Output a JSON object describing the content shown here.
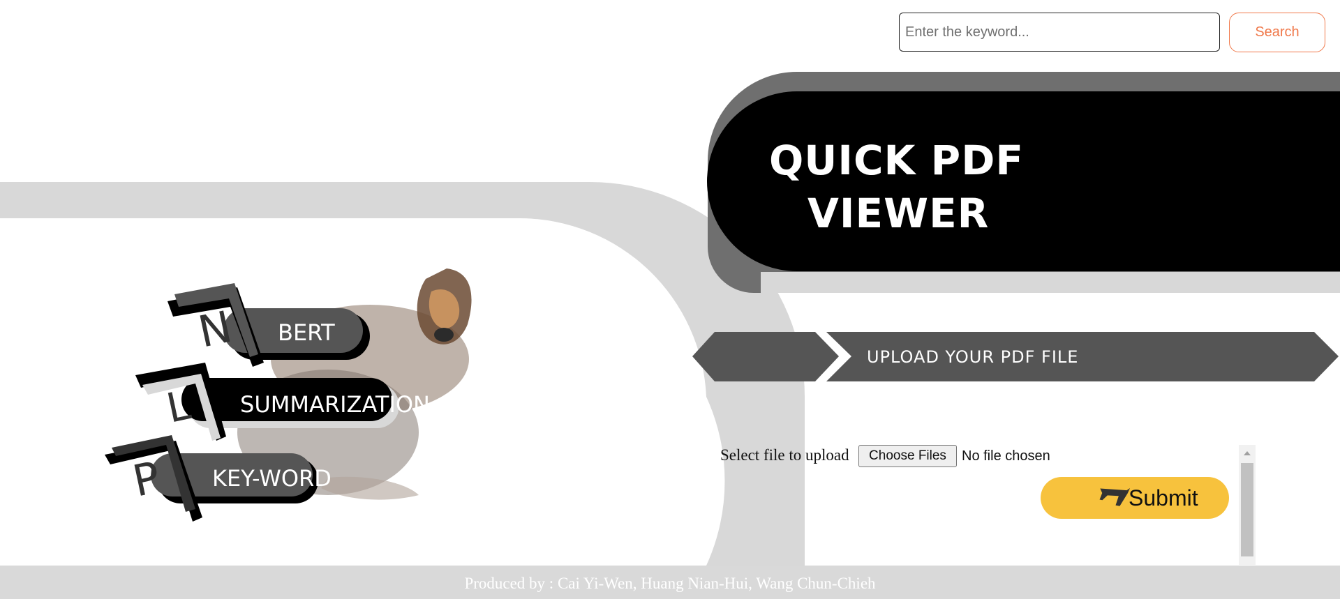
{
  "search": {
    "placeholder": "Enter the keyword...",
    "button_label": "Search"
  },
  "hero": {
    "title_line1": "QUICK PDF",
    "title_line2": "VIEWER"
  },
  "upload": {
    "banner_label": "UPLOAD YOUR PDF FILE",
    "select_label": "Select file to upload",
    "choose_button": "Choose Files",
    "no_file_text": "No file chosen",
    "submit_label": "Submit"
  },
  "logo": {
    "letters": [
      "N",
      "L",
      "P"
    ],
    "pills": [
      "BERT",
      "SUMMARIZATION",
      "KEY-WORD"
    ]
  },
  "footer": {
    "text": "Produced by : Cai Yi-Wen, Huang Nian-Hui, Wang Chun-Chieh"
  },
  "colors": {
    "accent_orange": "#f0784a",
    "submit_yellow": "#f7c23d",
    "banner_black": "#000000",
    "banner_gray": "#555555",
    "swoosh_gray": "#d8d8d8"
  },
  "icons": [
    "airplane-icon"
  ]
}
